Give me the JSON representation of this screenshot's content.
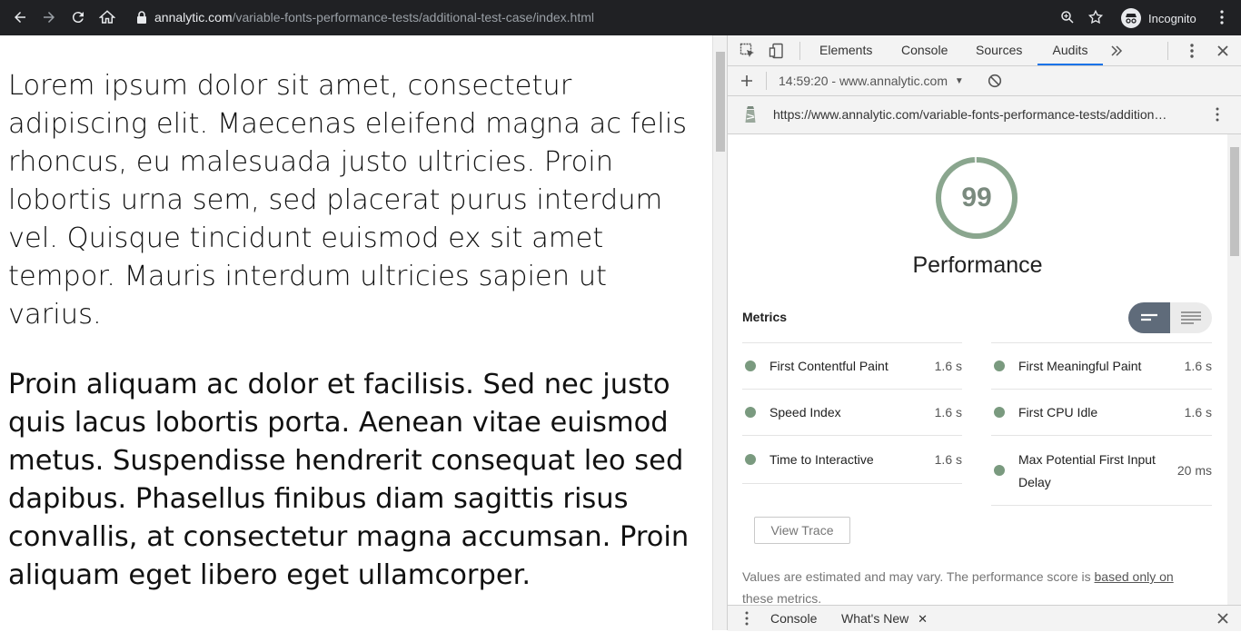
{
  "browser": {
    "url_domain": "annalytic.com",
    "url_path": "/variable-fonts-performance-tests/additional-test-case/index.html",
    "incognito_label": "Incognito"
  },
  "page": {
    "paragraph1": "Lorem ipsum dolor sit amet, consectetur adipiscing elit. Maecenas eleifend magna ac felis rhoncus, eu malesuada justo ultricies. Proin lobortis urna sem, sed placerat purus interdum vel. Quisque tincidunt euismod ex sit amet tempor. Mauris interdum ultricies sapien ut varius.",
    "paragraph2": "Proin aliquam ac dolor et facilisis. Sed nec justo quis lacus lobortis porta. Aenean vitae euismod metus. Suspendisse hendrerit consequat leo sed dapibus. Phasellus finibus diam sagittis risus convallis, at consectetur magna accumsan. Proin aliquam eget libero eget ullamcorper."
  },
  "devtools": {
    "tabs": [
      "Elements",
      "Console",
      "Sources",
      "Audits"
    ],
    "active_tab": "Audits",
    "run_label": "14:59:20 - www.annalytic.com",
    "report_url": "https://www.annalytic.com/variable-fonts-performance-tests/addition…",
    "score": "99",
    "score_fraction": 0.99,
    "category_title": "Performance",
    "metrics_heading": "Metrics",
    "metrics_left": [
      {
        "name": "First Contentful Paint",
        "value": "1.6 s"
      },
      {
        "name": "Speed Index",
        "value": "1.6 s"
      },
      {
        "name": "Time to Interactive",
        "value": "1.6 s"
      }
    ],
    "metrics_right": [
      {
        "name": "First Meaningful Paint",
        "value": "1.6 s"
      },
      {
        "name": "First CPU Idle",
        "value": "1.6 s"
      },
      {
        "name_line1": "Max Potential First Input",
        "name_line2": "Delay",
        "value": "20 ms"
      }
    ],
    "view_trace_label": "View Trace",
    "note_text": "Values are estimated and may vary. The performance score is ",
    "note_link": "based only on",
    "note_cont": "these metrics.",
    "drawer_tabs": [
      "Console",
      "What's New"
    ]
  },
  "colors": {
    "pass": "#7a9a7f",
    "gauge_ring": "#8aa68e",
    "accent": "#1a73e8"
  }
}
